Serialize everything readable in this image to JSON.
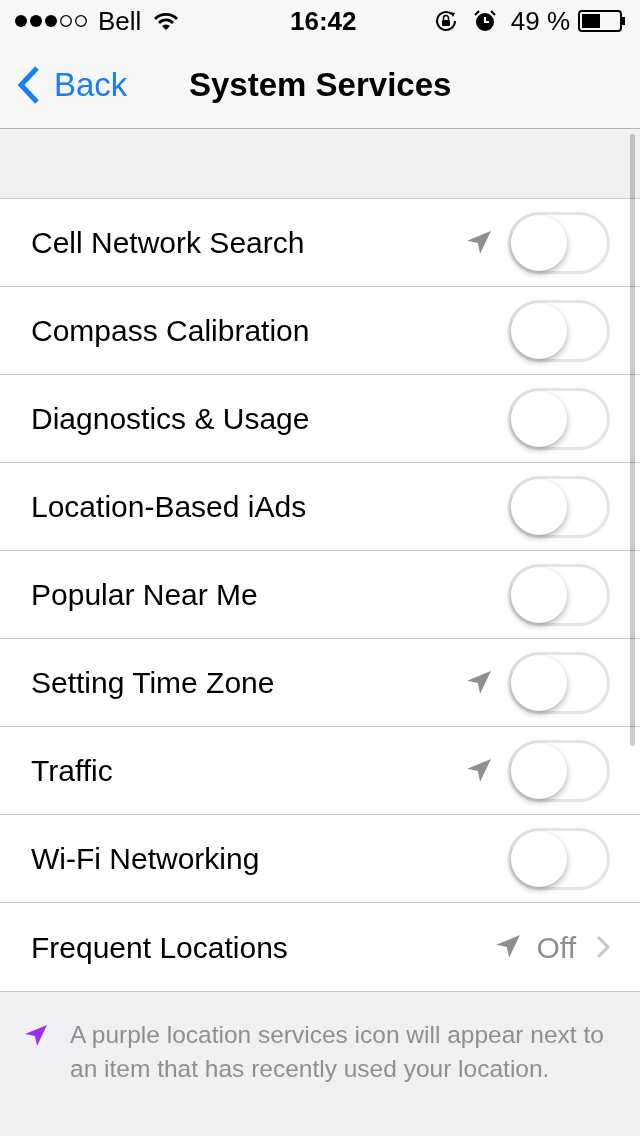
{
  "status_bar": {
    "carrier": "Bell",
    "time": "16:42",
    "battery": "49 %"
  },
  "nav": {
    "back": "Back",
    "title": "System Services"
  },
  "rows": [
    {
      "kind": "toggle",
      "label": "Cell Network Search",
      "location_icon": true,
      "on": false
    },
    {
      "kind": "toggle",
      "label": "Compass Calibration",
      "location_icon": false,
      "on": false
    },
    {
      "kind": "toggle",
      "label": "Diagnostics & Usage",
      "location_icon": false,
      "on": false
    },
    {
      "kind": "toggle",
      "label": "Location-Based iAds",
      "location_icon": false,
      "on": false
    },
    {
      "kind": "toggle",
      "label": "Popular Near Me",
      "location_icon": false,
      "on": false
    },
    {
      "kind": "toggle",
      "label": "Setting Time Zone",
      "location_icon": true,
      "on": false
    },
    {
      "kind": "toggle",
      "label": "Traffic",
      "location_icon": true,
      "on": false
    },
    {
      "kind": "toggle",
      "label": "Wi-Fi Networking",
      "location_icon": false,
      "on": false
    },
    {
      "kind": "disclosure",
      "label": "Frequent Locations",
      "location_icon": true,
      "value": "Off"
    }
  ],
  "footer": "A purple location services icon will appear next to an item that has recently used your location."
}
